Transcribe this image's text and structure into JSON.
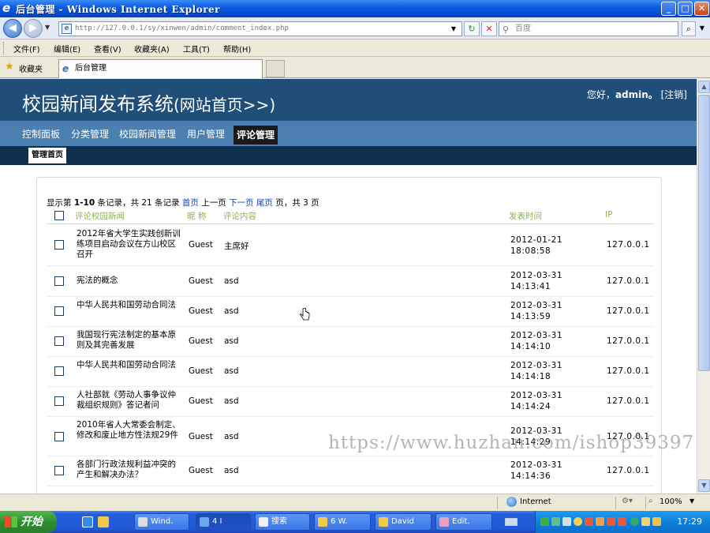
{
  "window": {
    "title": "后台管理 - Windows Internet Explorer",
    "minimize": "_",
    "maximize": "□",
    "close": "✕"
  },
  "address_bar": {
    "url": "http://127.0.0.1/sy/xinwen/admin/comment_index.php",
    "search_placeholder": "百度"
  },
  "menu": [
    "文件(F)",
    "编辑(E)",
    "查看(V)",
    "收藏夹(A)",
    "工具(T)",
    "帮助(H)"
  ],
  "favorites": {
    "label": "收藏夹",
    "tab_title": "后台管理"
  },
  "site": {
    "title": "校园新闻发布系统",
    "home_link": "(网站首页>>)",
    "greeting_prefix": "您好，",
    "username": "admin。",
    "logout": "[注销]"
  },
  "nav": {
    "items": [
      "控制面板",
      "分类管理",
      "校园新闻管理",
      "用户管理",
      "评论管理"
    ],
    "active_index": 4,
    "sub_item": "管理首页"
  },
  "pager": {
    "prefix": "显示第",
    "range": "1-10",
    "mid1": "条记录，共",
    "total": "21",
    "mid2": "条记录",
    "first": "首页",
    "prev": "上一页",
    "next": "下一页",
    "last": "尾页",
    "mid3": "页，共",
    "pages": "3",
    "suffix": "页"
  },
  "table": {
    "headers": [
      "评论校园新闻",
      "昵 称",
      "评论内容",
      "发表时间",
      "IP"
    ],
    "rows": [
      {
        "title": "2012年省大学生实践创新训练项目启动会议在方山校区召开",
        "nick": "Guest",
        "content": "主席好",
        "time": "2012-01-21 18:08:58",
        "ip": "127.0.0.1"
      },
      {
        "title": "宪法的概念",
        "nick": "Guest",
        "content": "asd",
        "time": "2012-03-31 14:13:41",
        "ip": "127.0.0.1"
      },
      {
        "title": "中华人民共和国劳动合同法",
        "nick": "Guest",
        "content": "asd",
        "time": "2012-03-31 14:13:59",
        "ip": "127.0.0.1"
      },
      {
        "title": "我国现行宪法制定的基本原则及其完善发展",
        "nick": "Guest",
        "content": "asd",
        "time": "2012-03-31 14:14:10",
        "ip": "127.0.0.1"
      },
      {
        "title": "中华人民共和国劳动合同法",
        "nick": "Guest",
        "content": "asd",
        "time": "2012-03-31 14:14:18",
        "ip": "127.0.0.1"
      },
      {
        "title": "人社部就《劳动人事争议仲裁组织规则》答记者问",
        "nick": "Guest",
        "content": "asd",
        "time": "2012-03-31 14:14:24",
        "ip": "127.0.0.1"
      },
      {
        "title": "2010年省人大常委会制定、修改和废止地方性法规29件",
        "nick": "Guest",
        "content": "asd",
        "time": "2012-03-31 14:14:29",
        "ip": "127.0.0.1"
      },
      {
        "title": "各部门行政法规利益冲突的产生和解决办法？",
        "nick": "Guest",
        "content": "asd",
        "time": "2012-03-31 14:14:36",
        "ip": "127.0.0.1"
      }
    ]
  },
  "status_bar": {
    "zone": "Internet",
    "zoom": "100%"
  },
  "taskbar": {
    "start": "开始",
    "buttons": [
      "Wind.",
      "4 I",
      "搜索",
      "6 W.",
      "David",
      "Edit."
    ],
    "clock": "17:29"
  },
  "watermark": "https://www.huzhan.com/ishop39397"
}
